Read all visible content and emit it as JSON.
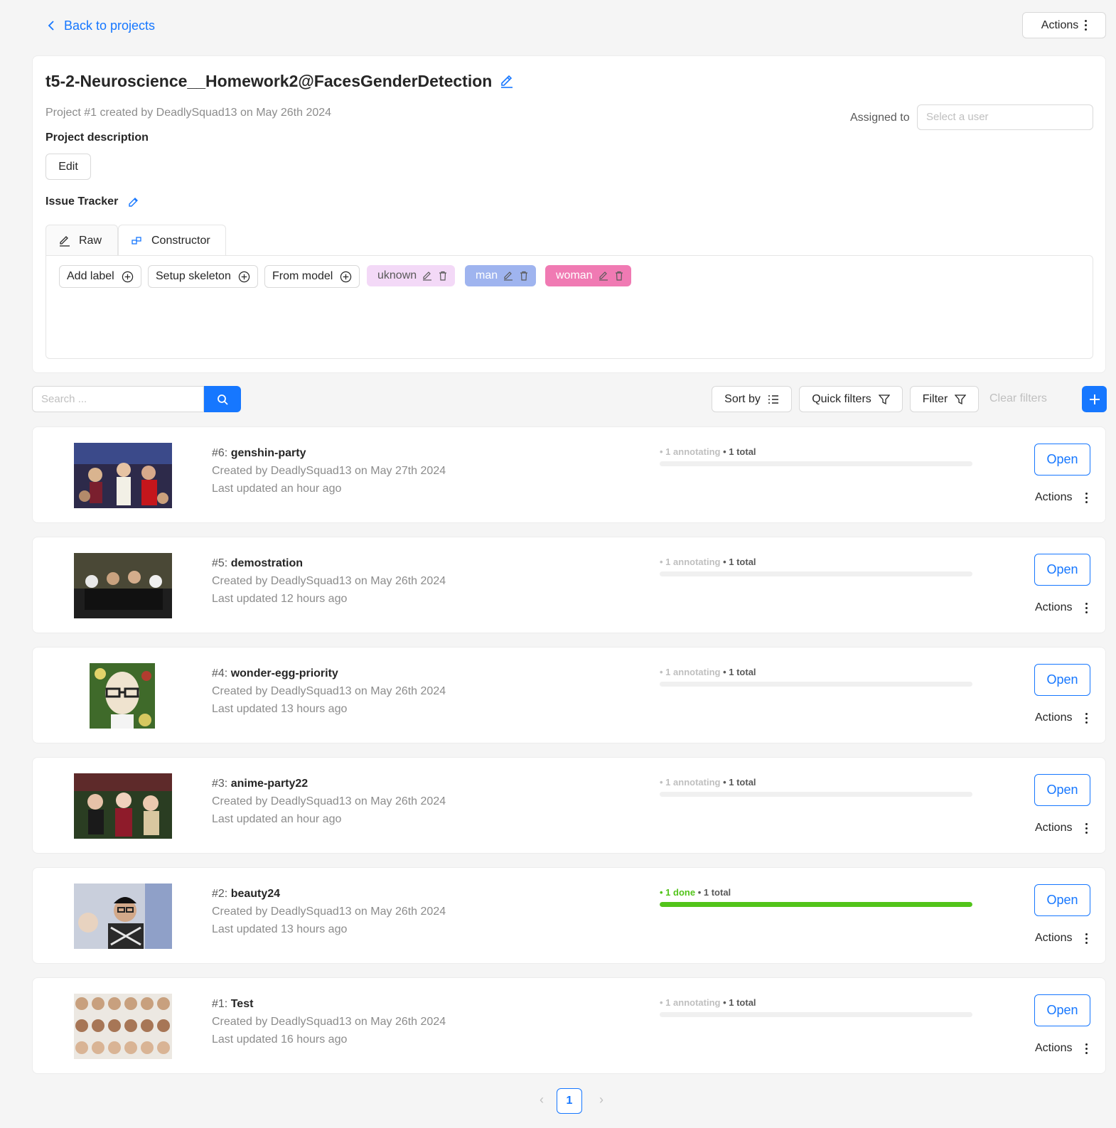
{
  "nav": {
    "back_label": "Back to projects",
    "actions_label": "Actions"
  },
  "project": {
    "title": "t5-2-Neuroscience__Homework2@FacesGenderDetection",
    "meta": "Project #1 created by DeadlySquad13 on May 26th 2024",
    "assigned_label": "Assigned to",
    "assigned_placeholder": "Select a user",
    "description_label": "Project description",
    "edit_label": "Edit",
    "issue_tracker_label": "Issue Tracker"
  },
  "tabs": {
    "raw": "Raw",
    "constructor": "Constructor"
  },
  "constructor": {
    "add_label": "Add label",
    "setup_skeleton": "Setup skeleton",
    "from_model": "From model",
    "labels": [
      {
        "name": "uknown",
        "color": "#f3d9f7"
      },
      {
        "name": "man",
        "color": "#9fb4ef"
      },
      {
        "name": "woman",
        "color": "#f07ab3"
      }
    ]
  },
  "toolbar": {
    "search_placeholder": "Search ...",
    "sort_by": "Sort by",
    "quick_filters": "Quick filters",
    "filter": "Filter",
    "clear_filters": "Clear filters"
  },
  "tasks": [
    {
      "id": "#6:",
      "name": "genshin-party",
      "created": "Created by DeadlySquad13 on May 27th 2024",
      "updated": "Last updated an hour ago",
      "state_count": "1",
      "state_text": "annotating",
      "total_text": "1 total",
      "progress": 0,
      "open": "Open",
      "actions": "Actions",
      "image": "party-crowd-photo"
    },
    {
      "id": "#5:",
      "name": "demostration",
      "created": "Created by DeadlySquad13 on May 26th 2024",
      "updated": "Last updated 12 hours ago",
      "state_count": "1",
      "state_text": "annotating",
      "total_text": "1 total",
      "progress": 0,
      "open": "Open",
      "actions": "Actions",
      "image": "group-on-sofa-photo"
    },
    {
      "id": "#4:",
      "name": "wonder-egg-priority",
      "created": "Created by DeadlySquad13 on May 26th 2024",
      "updated": "Last updated 13 hours ago",
      "state_count": "1",
      "state_text": "annotating",
      "total_text": "1 total",
      "progress": 0,
      "open": "Open",
      "actions": "Actions",
      "image": "anime-character-illustration"
    },
    {
      "id": "#3:",
      "name": "anime-party22",
      "created": "Created by DeadlySquad13 on May 26th 2024",
      "updated": "Last updated an hour ago",
      "state_count": "1",
      "state_text": "annotating",
      "total_text": "1 total",
      "progress": 0,
      "open": "Open",
      "actions": "Actions",
      "image": "party-people-photo"
    },
    {
      "id": "#2:",
      "name": "beauty24",
      "created": "Created by DeadlySquad13 on May 26th 2024",
      "updated": "Last updated 13 hours ago",
      "state_count": "1",
      "state_text": "done",
      "total_text": "1 total",
      "progress": 1,
      "open": "Open",
      "actions": "Actions",
      "image": "portrait-photo"
    },
    {
      "id": "#1:",
      "name": "Test",
      "created": "Created by DeadlySquad13 on May 26th 2024",
      "updated": "Last updated 16 hours ago",
      "state_count": "1",
      "state_text": "annotating",
      "total_text": "1 total",
      "progress": 0,
      "open": "Open",
      "actions": "Actions",
      "image": "faces-grid-photo"
    }
  ],
  "pagination": {
    "current": "1"
  },
  "colors": {
    "accent": "#1677ff",
    "done": "#52c41a"
  }
}
